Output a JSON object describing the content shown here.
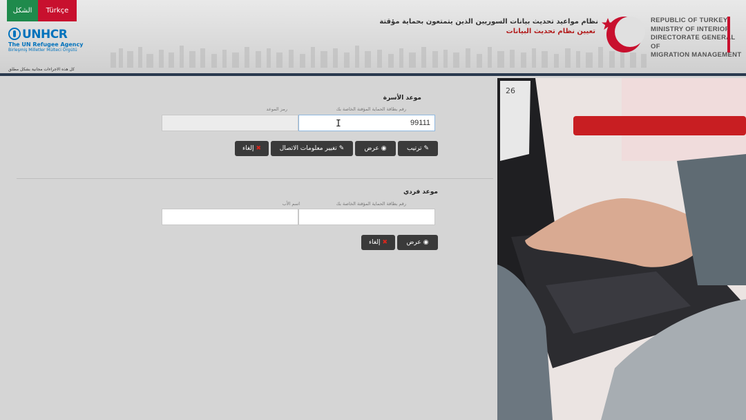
{
  "header": {
    "lang_arabic": "الشكل",
    "lang_turkish": "Türkçe",
    "unhcr_name": "UNHCR",
    "unhcr_sub1": "The UN Refugee Agency",
    "unhcr_sub2": "Birleşmiş Milletler Mülteci Örgütü",
    "title_ar_line1": "نظام مواعيد تحديث بيانات السوريين الذين يتمتعون بحماية مؤقتة",
    "title_ar_line2": "تعيين نظام تحديث البيانات",
    "dgmm_lines": [
      "REPUBLIC OF TURKEY",
      "MINISTRY OF INTERIOR",
      "DIRECTORATE GENERAL OF",
      "MIGRATION MANAGEMENT"
    ],
    "sub_bar_text": "كل هذه الاجراءات مجانية بشكل مطلق",
    "colors": {
      "green": "#1f8a4c",
      "red": "#c8102e",
      "navy": "#2a3a4f",
      "unhcr_blue": "#0072bc"
    }
  },
  "family": {
    "title": "موعد الأسرة",
    "id_label": "رقم بطاقة الحماية المؤقتة الخاصة بك",
    "code_label": "رمز الموعد",
    "id_value": "99111",
    "code_value": "",
    "buttons": {
      "arrange": "ترتيب",
      "view": "عرض",
      "change_contact": "تغيير معلومات الاتصال",
      "cancel": "إلغاء"
    }
  },
  "individual": {
    "title": "موعد فردي",
    "id_label": "رقم بطاقة الحماية المؤقتة الخاصة بك",
    "father_label": "اسم الأب",
    "id_value": "",
    "father_value": "",
    "buttons": {
      "view": "عرض",
      "cancel": "إلغاء"
    }
  }
}
